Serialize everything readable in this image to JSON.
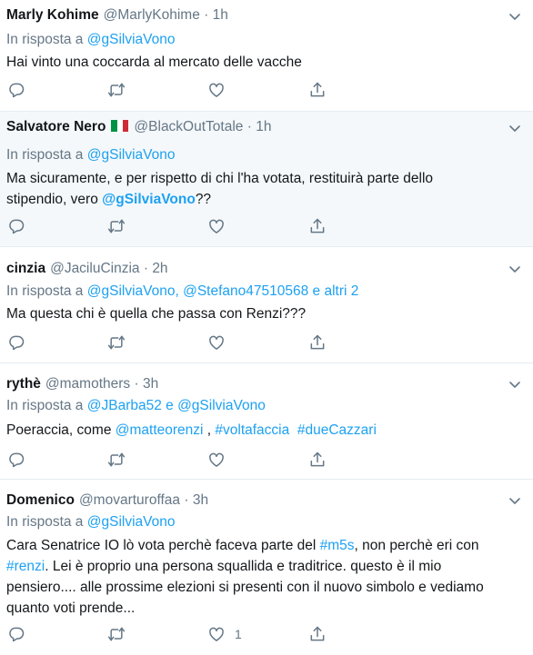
{
  "colors": {
    "link": "#1da1f2",
    "muted": "#657786",
    "text": "#14171a",
    "highlight_bg": "#f5f8fa",
    "border": "#e6ecf0"
  },
  "icons": [
    "reply-icon",
    "retweet-icon",
    "like-icon",
    "share-icon",
    "chevron-down-icon"
  ],
  "tweets": [
    {
      "name": "Marly Kohime",
      "handle": "@MarlyKohime",
      "dot": "·",
      "time": "1h",
      "reply_prefix": "In risposta a ",
      "reply_to": "@gSilviaVono",
      "text": "Hai vinto una coccarda al mercato delle vacche"
    },
    {
      "name": "Salvatore Nero",
      "flag": "italy-flag",
      "handle": "@BlackOutTotale",
      "dot": "·",
      "time": "1h",
      "reply_prefix": "In risposta a ",
      "reply_to": "@gSilviaVono",
      "text_line1": "Ma sicuramente, e per rispetto di chi l'ha votata, restituirà parte dello",
      "text_line2_a": "stipendio, vero ",
      "text_line2_mention": "@gSilviaVono",
      "text_line2_b": "??"
    },
    {
      "name": "cinzia",
      "handle": "@JaciluCinzia",
      "dot": "·",
      "time": "2h",
      "reply_prefix": "In risposta a ",
      "reply_to": "@gSilviaVono, @Stefano47510568 e altri 2",
      "text": "Ma questa chi è quella che passa con Renzi???"
    },
    {
      "name": "rythè",
      "handle": "@mamothers",
      "dot": "·",
      "time": "3h",
      "reply_prefix": "In risposta a ",
      "reply_to": "@JBarba52 e @gSilviaVono",
      "text_a": "Poeraccia, come ",
      "link1": "@matteorenzi",
      "text_b": " , ",
      "link2": "#voltafaccia",
      "text_c": "  ",
      "link3": "#dueCazzari"
    },
    {
      "name": "Domenico",
      "handle": "@movarturoffaa",
      "dot": "·",
      "time": "3h",
      "reply_prefix": "In risposta a ",
      "reply_to": "@gSilviaVono",
      "l1_a": "Cara Senatrice IO lò vota perchè faceva parte del ",
      "l1_link": "#m5s",
      "l1_b": ", non perchè eri con",
      "l2_link": "#renzi",
      "l2_b": ". Lei è proprio una persona squallida e traditrice. questo è il mio",
      "l3": "pensiero.... alle prossime elezioni si presenti con il nuovo simbolo e vediamo",
      "l4": "quanto voti prende...",
      "like_count": "1"
    }
  ]
}
